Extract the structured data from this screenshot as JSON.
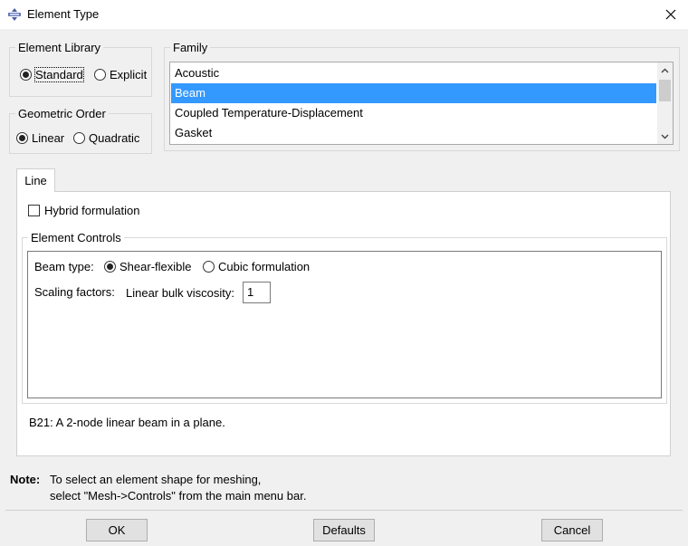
{
  "window": {
    "title": "Element Type"
  },
  "element_library": {
    "legend": "Element Library",
    "options": [
      {
        "label": "Standard",
        "selected": true
      },
      {
        "label": "Explicit",
        "selected": false
      }
    ]
  },
  "geometric_order": {
    "legend": "Geometric Order",
    "options": [
      {
        "label": "Linear",
        "selected": true
      },
      {
        "label": "Quadratic",
        "selected": false
      }
    ]
  },
  "family": {
    "legend": "Family",
    "items": [
      "Acoustic",
      "Beam",
      "Coupled Temperature-Displacement",
      "Gasket"
    ],
    "selected": "Beam"
  },
  "tabs": [
    {
      "label": "Line",
      "active": true
    }
  ],
  "hybrid": {
    "label": "Hybrid formulation",
    "checked": false
  },
  "element_controls": {
    "legend": "Element Controls",
    "beam_type_label": "Beam type:",
    "beam_type_options": [
      {
        "label": "Shear-flexible",
        "selected": true
      },
      {
        "label": "Cubic formulation",
        "selected": false
      }
    ],
    "scaling_label": "Scaling factors:",
    "viscosity_label": "Linear bulk viscosity:",
    "viscosity_value": "1"
  },
  "description": "B21:  A 2-node linear beam in a plane.",
  "note": {
    "label": "Note:",
    "line1": "To select an element shape for meshing,",
    "line2": "select \"Mesh->Controls\" from the main menu bar."
  },
  "buttons": {
    "ok": "OK",
    "defaults": "Defaults",
    "cancel": "Cancel"
  },
  "colors": {
    "selection": "#3399ff",
    "background": "#f0f0f0"
  }
}
